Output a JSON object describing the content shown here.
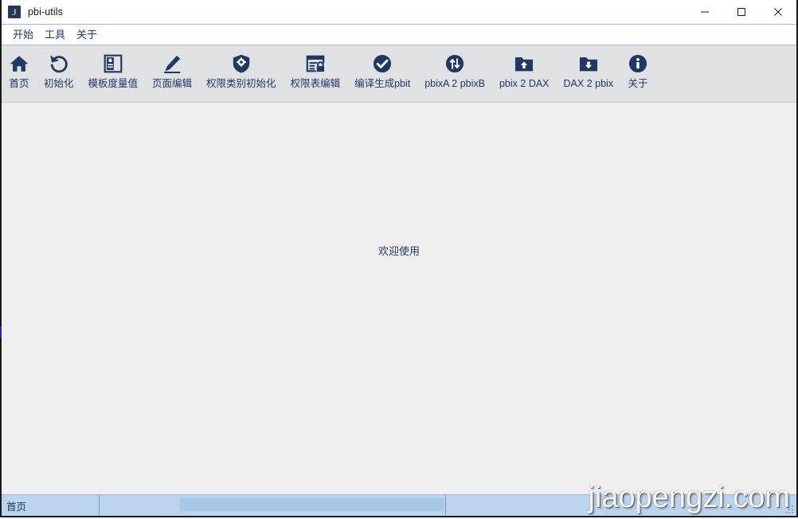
{
  "window": {
    "title": "pbi-utils",
    "app_icon_letter": "J",
    "controls": [
      {
        "name": "minimize",
        "glyph": "minimize-icon"
      },
      {
        "name": "maximize",
        "glyph": "maximize-icon"
      },
      {
        "name": "close",
        "glyph": "close-icon"
      }
    ]
  },
  "menu": {
    "items": [
      {
        "label": "开始"
      },
      {
        "label": "工具"
      },
      {
        "label": "关于"
      }
    ]
  },
  "toolbar": {
    "buttons": [
      {
        "label": "首页",
        "icon": "home-icon"
      },
      {
        "label": "初始化",
        "icon": "reset-circular-arrow-icon"
      },
      {
        "label": "模板度量值",
        "icon": "template-panel-icon"
      },
      {
        "label": "页面编辑",
        "icon": "pencil-edit-icon"
      },
      {
        "label": "权限类别初始化",
        "icon": "shield-gear-icon"
      },
      {
        "label": "权限表编辑",
        "icon": "table-lock-icon"
      },
      {
        "label": "编译生成pbit",
        "icon": "check-circle-icon"
      },
      {
        "label": "pbixA 2 pbixB",
        "icon": "transfer-arrows-circle-icon"
      },
      {
        "label": "pbix 2 DAX",
        "icon": "folder-up-arrow-icon"
      },
      {
        "label": "DAX 2 pbix",
        "icon": "folder-down-arrow-icon"
      },
      {
        "label": "关于",
        "icon": "info-circle-icon"
      }
    ]
  },
  "content": {
    "welcome_message": "欢迎使用"
  },
  "status_bar": {
    "left_label": "首页",
    "progress_value": ""
  },
  "watermark": {
    "text": "jiaopengzi.com"
  },
  "colors": {
    "icon_navy": "#1f3864",
    "toolbar_bg": "#e0e1e3",
    "content_bg": "#efefef",
    "status_bg": "#bcd4ee",
    "title_text": "#111111",
    "accent_blue_border": "#9fb6d4"
  }
}
